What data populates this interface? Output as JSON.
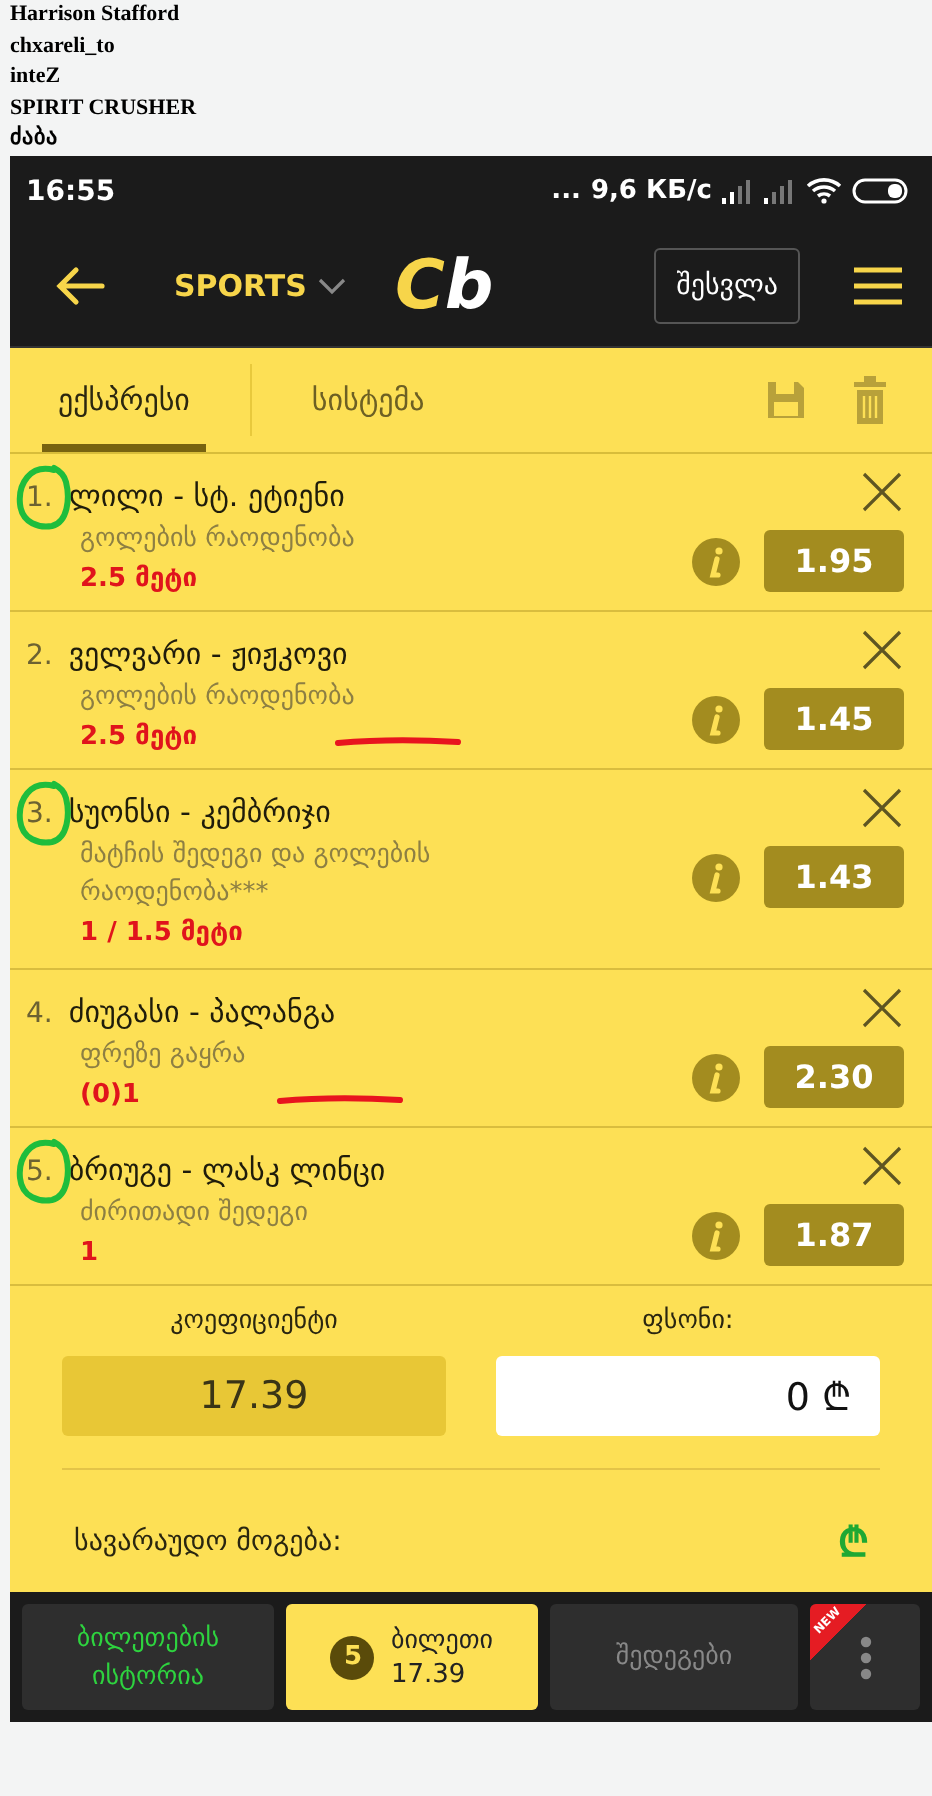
{
  "usernames": [
    "Harrison Stafford",
    "chxareli_to",
    "inteZ",
    "SPIRIT CRUSHER",
    "ძაბა"
  ],
  "status_bar": {
    "time": "16:55",
    "dots": "...",
    "speed": "9,6 КБ/с"
  },
  "header": {
    "sports": "SPORTS",
    "logo_c": "C",
    "logo_b": "b",
    "login": "შესვლა"
  },
  "tabs": [
    {
      "label": "ექსპრესი",
      "selected": true
    },
    {
      "label": "სისტემა",
      "selected": false
    }
  ],
  "bets": [
    {
      "number": "1.",
      "match": "ლილი - სტ. ეტიენი",
      "market": "გოლების რაოდენობა",
      "pick": "2.5 მეტი",
      "odds": "1.95",
      "circled": true,
      "underlined": false
    },
    {
      "number": "2.",
      "match": "ველვარი - ჟიჟკოვი",
      "market": "გოლების რაოდენობა",
      "pick": "2.5 მეტი",
      "odds": "1.45",
      "circled": false,
      "underlined": true
    },
    {
      "number": "3.",
      "match": "სუონსი - კემბრიჯი",
      "market": "მატჩის შედეგი და გოლების რაოდენობა***",
      "pick": "1 / 1.5 მეტი",
      "odds": "1.43",
      "circled": true,
      "underlined": false
    },
    {
      "number": "4.",
      "match": "ძიუგასი - პალანგა",
      "market": "ფრეზე გაყრა",
      "pick": "(0)1",
      "odds": "2.30",
      "circled": false,
      "underlined": true
    },
    {
      "number": "5.",
      "match": "ბრიუგე - ლასკ ლინცი",
      "market": "ძირითადი შედეგი",
      "pick": "1",
      "odds": "1.87",
      "circled": true,
      "underlined": false
    }
  ],
  "summary": {
    "coef_label": "კოეფიციენტი",
    "coef_value": "17.39",
    "stake_label": "ფსონი:",
    "stake_value": "0",
    "currency": "₾",
    "win_label": "სავარაუდო მოგება:",
    "win_currency": "₾"
  },
  "bottom_bar": {
    "history": "ბილეთების ისტორია",
    "count": "5",
    "ticket": "ბილეთი",
    "ticket_odds": "17.39",
    "results": "შედეგები",
    "new_badge": "NEW"
  }
}
